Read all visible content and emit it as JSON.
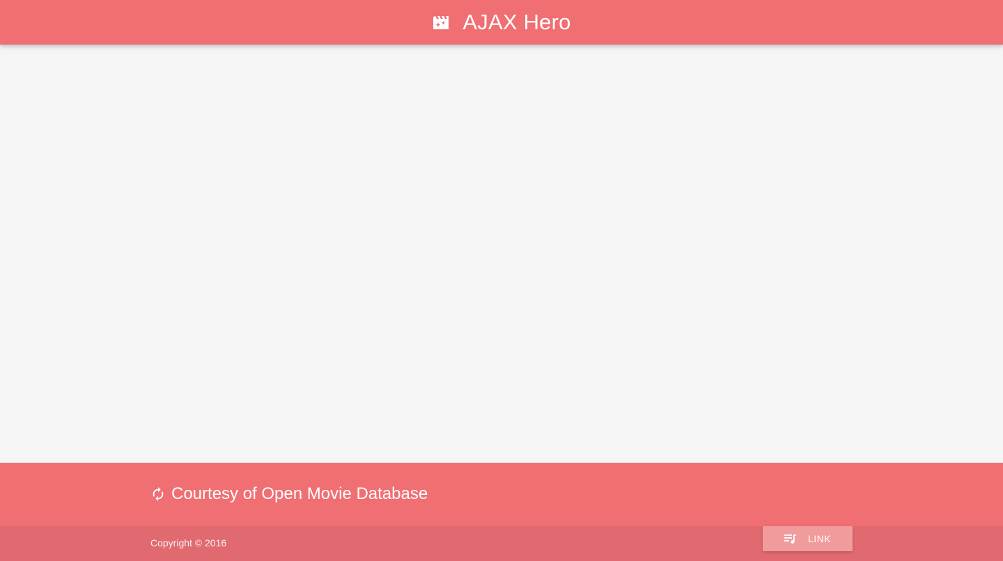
{
  "header": {
    "title": "AJAX Hero",
    "icon": "movie-filter-icon"
  },
  "footer": {
    "courtesy_text": "Courtesy of Open Movie Database",
    "courtesy_icon": "refresh-icon",
    "copyright": "Copyright © 2016",
    "link_button": {
      "label": "LINK",
      "icon": "queue-music-icon"
    }
  },
  "colors": {
    "primary": "#f06f73",
    "primary_dark": "#e06a6f",
    "button": "#f19b9c",
    "background": "#f5f5f5"
  }
}
